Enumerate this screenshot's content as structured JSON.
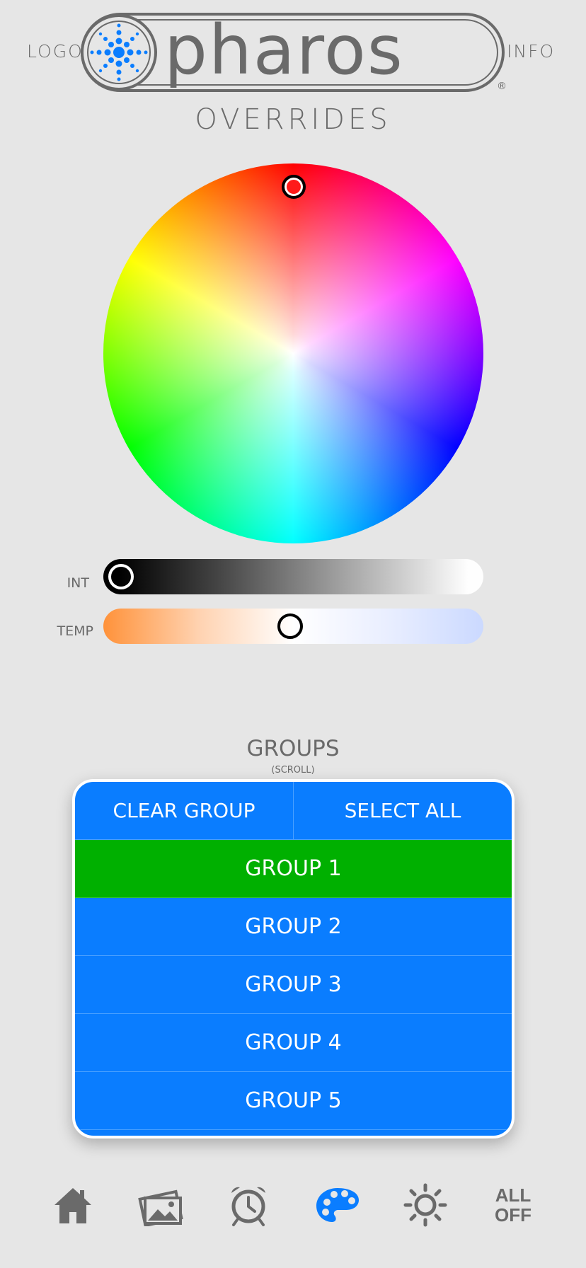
{
  "header": {
    "logout_label": "LOGOUT",
    "info_label": "INFO",
    "logo_text": "pharos",
    "logo_mark": "®",
    "page_title": "OVERRIDES"
  },
  "color_picker": {
    "selected_color": "#ff1a1a"
  },
  "sliders": {
    "intensity": {
      "label": "INT",
      "value_fraction": 0.0
    },
    "temperature": {
      "label": "TEMP",
      "value_fraction": 0.49
    }
  },
  "groups": {
    "title": "GROUPS",
    "hint": "(SCROLL)",
    "clear_label": "CLEAR GROUP",
    "select_all_label": "SELECT ALL",
    "items": [
      {
        "label": "GROUP 1",
        "selected": true
      },
      {
        "label": "GROUP 2",
        "selected": false
      },
      {
        "label": "GROUP 3",
        "selected": false
      },
      {
        "label": "GROUP 4",
        "selected": false
      },
      {
        "label": "GROUP 5",
        "selected": false
      }
    ]
  },
  "nav": {
    "items": [
      {
        "icon": "home-icon"
      },
      {
        "icon": "gallery-icon"
      },
      {
        "icon": "alarm-clock-icon"
      },
      {
        "icon": "palette-icon",
        "active": true
      },
      {
        "icon": "sun-icon"
      },
      {
        "icon": "all-off-icon",
        "line1": "ALL",
        "line2": "OFF"
      }
    ]
  },
  "colors": {
    "background": "#e6e6e6",
    "accent_blue": "#0a7dff",
    "selected_green": "#00b000",
    "text_gray": "#6a6a6a"
  }
}
